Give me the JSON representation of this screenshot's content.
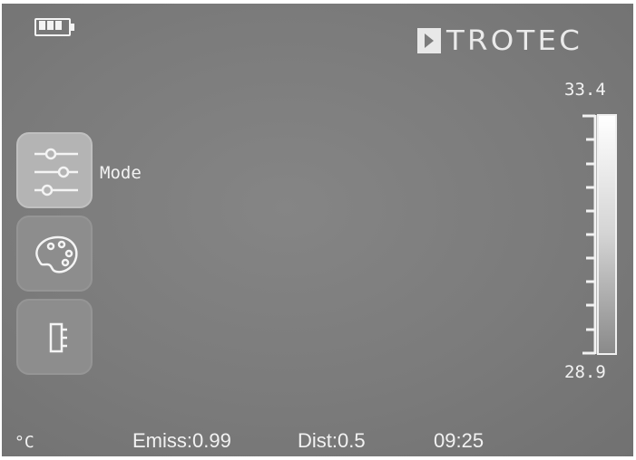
{
  "status_bar": {
    "unit": "°C",
    "emissivity": "Emiss:0.99",
    "distance": "Dist:0.5",
    "time": "09:25"
  },
  "brand": {
    "name": "TROTEC"
  },
  "battery": {
    "level_bars": 3,
    "icon": "battery-icon"
  },
  "menu": {
    "items": [
      {
        "icon": "sliders-icon",
        "label": "Mode",
        "active": true
      },
      {
        "icon": "palette-icon",
        "label": "",
        "active": false
      },
      {
        "icon": "battery-settings-icon",
        "label": "",
        "active": false
      }
    ]
  },
  "temperature_scale": {
    "max": "33.4",
    "min": "28.9"
  }
}
